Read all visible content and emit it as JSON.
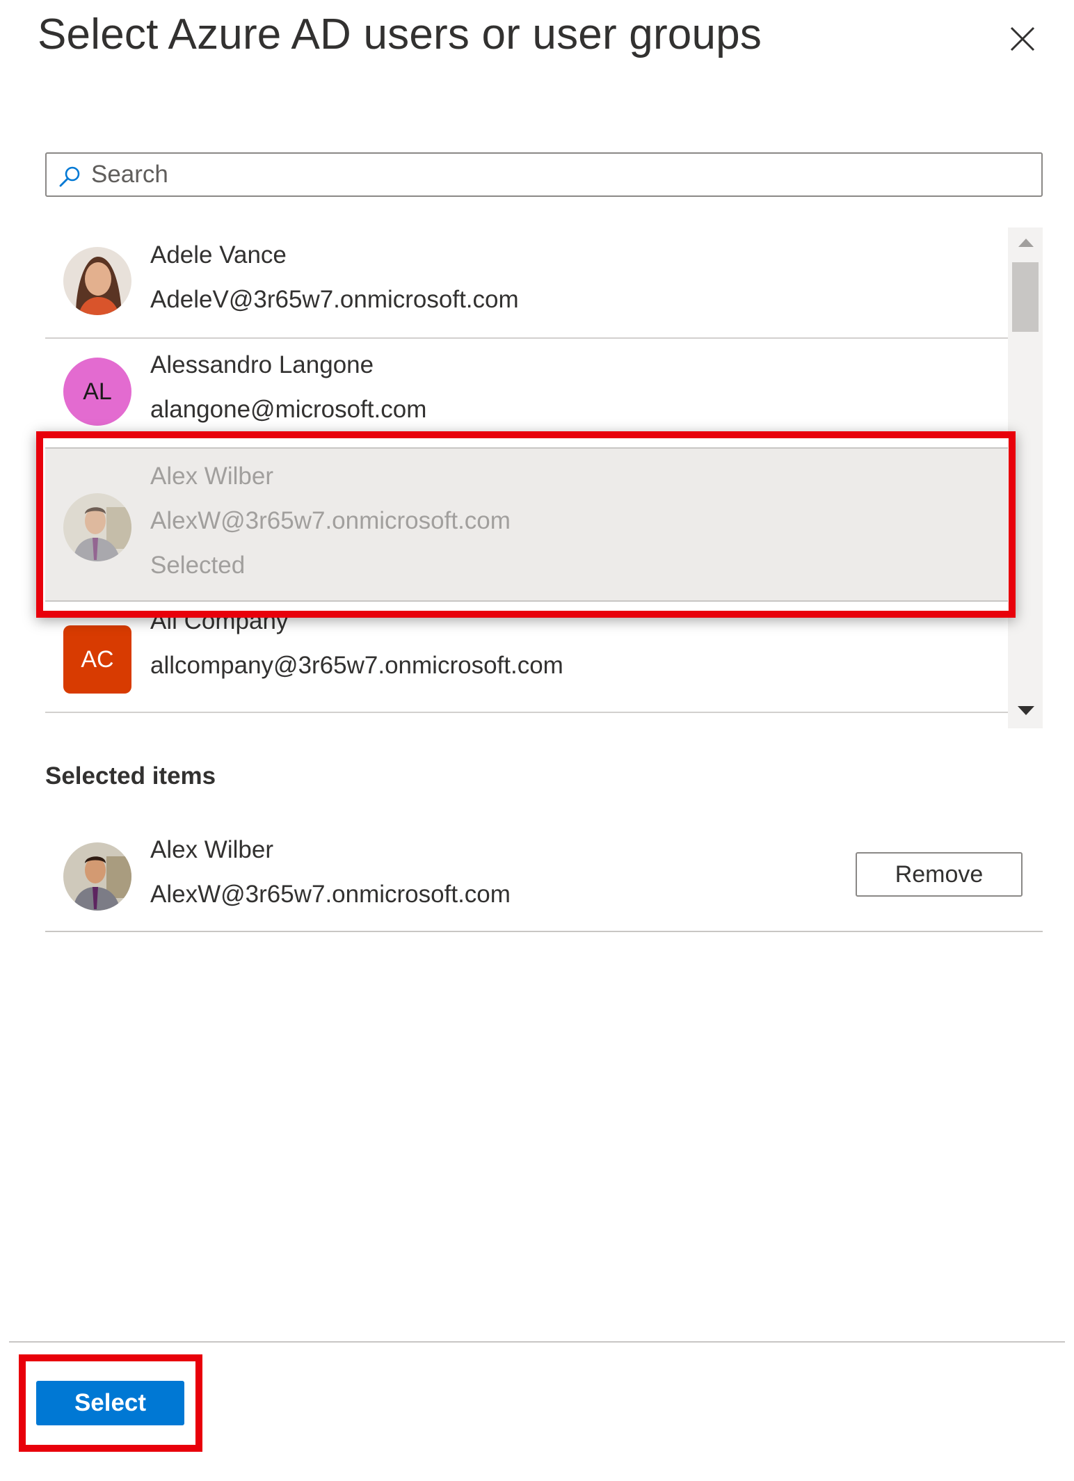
{
  "dialog": {
    "title": "Select Azure AD users or user groups",
    "close_label": "×"
  },
  "search": {
    "placeholder": "Search",
    "value": ""
  },
  "results": [
    {
      "name": "Adele Vance",
      "email": "AdeleV@3r65w7.onmicrosoft.com",
      "status": "",
      "avatar": "photo"
    },
    {
      "name": "Alessandro Langone",
      "email": "alangone@microsoft.com",
      "status": "",
      "avatar": "initials",
      "initials": "AL",
      "avatar_color": "#e36bd0"
    },
    {
      "name": "Alex Wilber",
      "email": "AlexW@3r65w7.onmicrosoft.com",
      "status": "Selected",
      "avatar": "photo"
    },
    {
      "name": "All Company",
      "email": "allcompany@3r65w7.onmicrosoft.com",
      "status": "",
      "avatar": "initials",
      "initials": "AC",
      "avatar_color": "#d83b01"
    }
  ],
  "selected_section": {
    "heading": "Selected items",
    "items": [
      {
        "name": "Alex Wilber",
        "email": "AlexW@3r65w7.onmicrosoft.com",
        "remove_label": "Remove"
      }
    ]
  },
  "footer": {
    "select_label": "Select"
  },
  "colors": {
    "accent": "#0078d4",
    "highlight": "#e8000b",
    "selected_row_bg": "#edebe9"
  },
  "icons": {
    "close": "close-icon",
    "search": "search-icon",
    "scroll_up": "scroll-up-arrow-icon",
    "scroll_down": "scroll-down-arrow-icon"
  }
}
